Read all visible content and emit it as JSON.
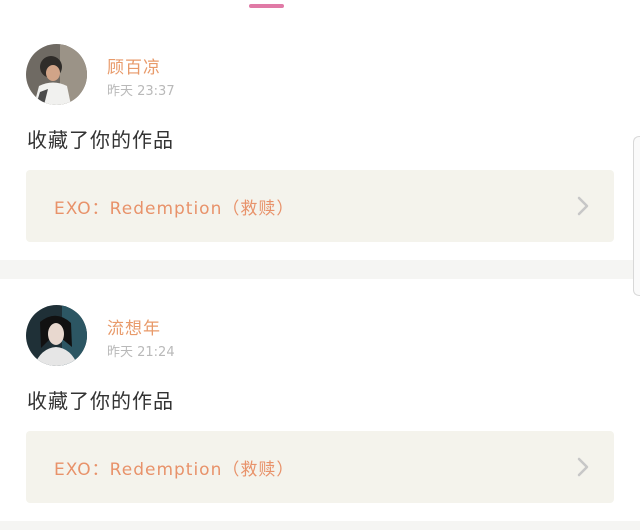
{
  "feed": {
    "items": [
      {
        "username": "顾百凉",
        "timestamp": "昨天 23:37",
        "action": "收藏了你的作品",
        "work_title": "EXO：Redemption（救赎）",
        "avatar_icon": "user-avatar-photo"
      },
      {
        "username": "流想年",
        "timestamp": "昨天 21:24",
        "action": "收藏了你的作品",
        "work_title": "EXO：Redemption（救赎）",
        "avatar_icon": "user-avatar-photo"
      }
    ]
  },
  "colors": {
    "accent": "#e07aa6",
    "username": "#e89a6a",
    "work_title": "#e8926a",
    "card_link_bg": "#f4f3ec",
    "separator": "#f5f5f3"
  }
}
